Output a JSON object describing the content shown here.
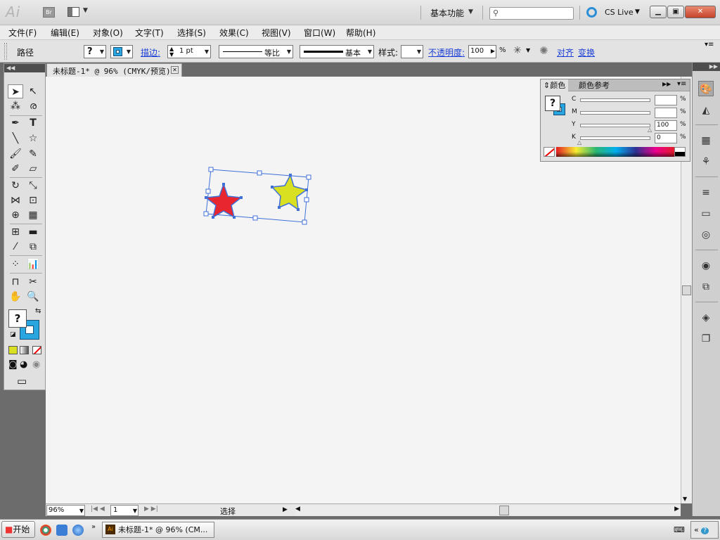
{
  "titlebar": {
    "app_logo": "Ai",
    "bridge": "Br",
    "workspace": "基本功能",
    "search_placeholder": "",
    "cslive": "CS Live",
    "window_buttons": {
      "min": "▁",
      "max": "▣",
      "close": "✕"
    }
  },
  "menu": [
    "文件(F)",
    "编辑(E)",
    "对象(O)",
    "文字(T)",
    "选择(S)",
    "效果(C)",
    "视图(V)",
    "窗口(W)",
    "帮助(H)"
  ],
  "control": {
    "selection_type": "路径",
    "fill_label": "?",
    "stroke_link": "描边:",
    "stroke_value": "1 pt",
    "stroke_profile": "等比",
    "brush": "基本",
    "style_label": "样式:",
    "opacity_link": "不透明度:",
    "opacity_value": "100",
    "opacity_unit": "%",
    "align_link": "对齐",
    "transform_link": "变换"
  },
  "document_tab": {
    "title": "未标题-1* @ 96% (CMYK/预览)",
    "close": "✕"
  },
  "color_panel": {
    "tabs": [
      "颜色",
      "颜色参考"
    ],
    "fill_indicator": "?",
    "channels": [
      {
        "label": "C",
        "value": "",
        "unit": "%"
      },
      {
        "label": "M",
        "value": "",
        "unit": "%"
      },
      {
        "label": "Y",
        "value": "100",
        "unit": "%"
      },
      {
        "label": "K",
        "value": "0",
        "unit": "%"
      }
    ]
  },
  "statusbar": {
    "zoom": "96%",
    "page": "1",
    "status": "选择"
  },
  "toolbox": {
    "fill_indicator": "?"
  },
  "canvas_objects": {
    "star_red_color": "#e8262f",
    "star_yellow_color": "#d9e021",
    "selection_color": "#3f6fd8"
  },
  "taskbar": {
    "start": "开始",
    "task": "未标题-1* @ 96% (CM..."
  }
}
